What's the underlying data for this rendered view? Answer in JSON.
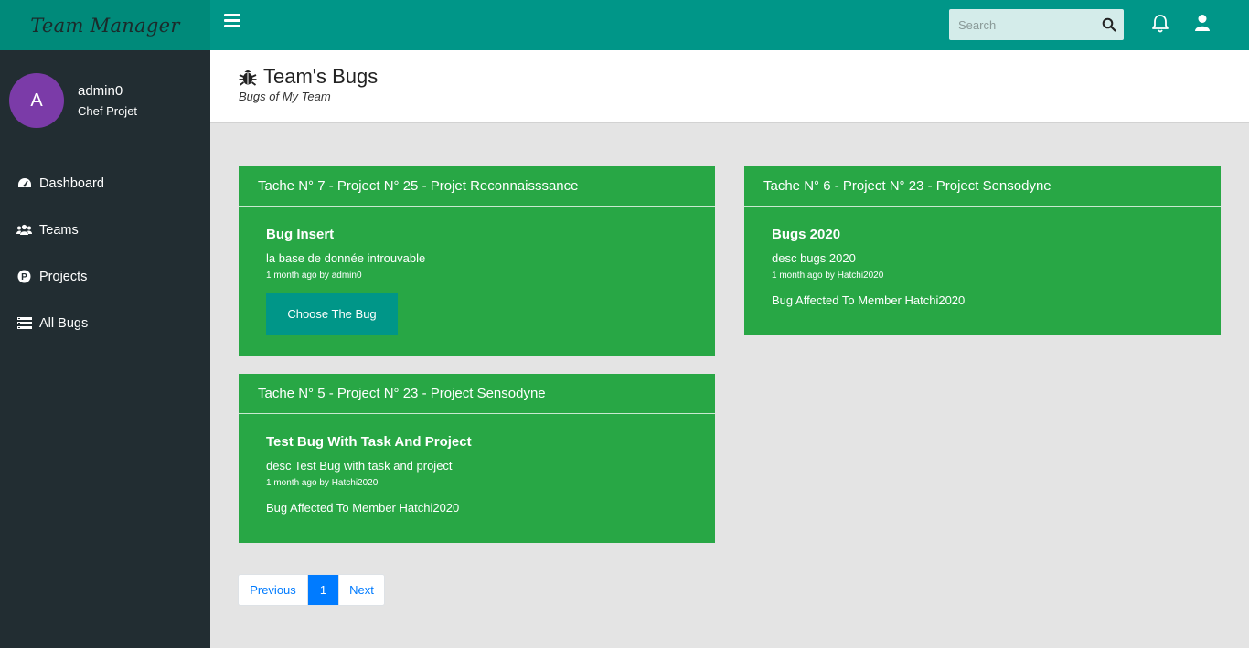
{
  "app": {
    "brand": "Team Manager"
  },
  "topbar": {
    "search_placeholder": "Search",
    "search_icon": "search-icon",
    "notifications_icon": "bell-icon",
    "user_icon": "user-icon"
  },
  "sidebar": {
    "avatar_letter": "A",
    "user_name": "admin0",
    "user_role": "Chef Projet",
    "items": [
      {
        "label": "Dashboard",
        "icon": "dashboard-icon"
      },
      {
        "label": "Teams",
        "icon": "users-icon"
      },
      {
        "label": "Projects",
        "icon": "project-icon"
      },
      {
        "label": "All Bugs",
        "icon": "list-icon"
      }
    ]
  },
  "page": {
    "title": "Team's Bugs",
    "subtitle": "Bugs of My Team",
    "title_icon": "bug-icon"
  },
  "cards": [
    {
      "header": "Tache N° 7 - Project N° 25 - Projet Reconnaisssance",
      "bug_title": "Bug Insert",
      "description": "la base de donnée introuvable",
      "meta": "1 month ago by  admin0",
      "button": "Choose The Bug"
    },
    {
      "header": "Tache N° 6 - Project N° 23 - Project Sensodyne",
      "bug_title": "Bugs 2020",
      "description": "desc bugs 2020",
      "meta": "1 month ago by  Hatchi2020",
      "affected": "Bug Affected To Member Hatchi2020"
    },
    {
      "header": "Tache N° 5 - Project N° 23 - Project Sensodyne",
      "bug_title": "Test Bug With Task And Project",
      "description": "desc Test Bug with task and project",
      "meta": "1 month ago by  Hatchi2020",
      "affected": "Bug Affected To Member Hatchi2020"
    }
  ],
  "pagination": {
    "previous": "Previous",
    "current": "1",
    "next": "Next"
  },
  "colors": {
    "primary": "#009688",
    "card": "#28a745",
    "sidebar": "#222d32",
    "avatar": "#7b3ba8",
    "link": "#007bff"
  }
}
